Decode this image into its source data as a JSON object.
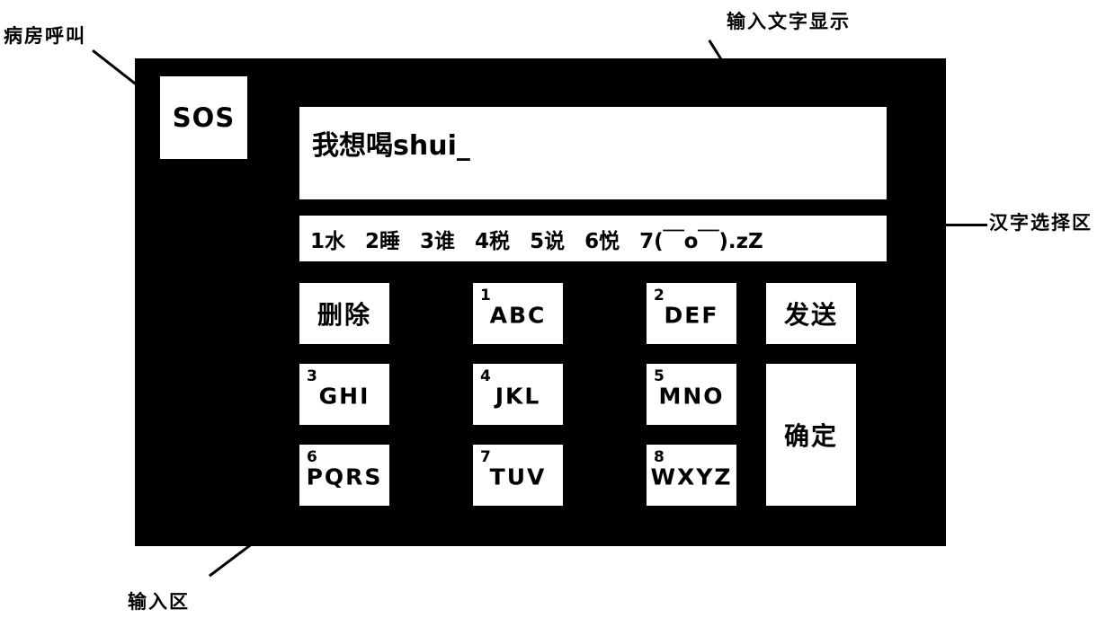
{
  "callouts": {
    "ward_call": "病房呼叫",
    "text_display": "输入文字显示",
    "hanzi_selection": "汉字选择区",
    "input_area": "输入区"
  },
  "device": {
    "frame_color": "#000000",
    "key_color": "#ffffff",
    "sos": {
      "label": "SOS"
    },
    "text_display": {
      "value": "我想喝shui_"
    },
    "candidates": [
      "1水",
      "2睡",
      "3谁",
      "4税",
      "5说",
      "6悦",
      "7(￣o￣).zZ"
    ],
    "keypad": {
      "keys": [
        {
          "digit": "",
          "letters": "",
          "cjk": "删除"
        },
        {
          "digit": "1",
          "letters": "ABC",
          "cjk": ""
        },
        {
          "digit": "2",
          "letters": "DEF",
          "cjk": ""
        },
        {
          "digit": "",
          "letters": "",
          "cjk": "发送"
        },
        {
          "digit": "3",
          "letters": "GHI",
          "cjk": ""
        },
        {
          "digit": "4",
          "letters": "JKL",
          "cjk": ""
        },
        {
          "digit": "5",
          "letters": "MNO",
          "cjk": ""
        },
        {
          "digit": "6",
          "letters": "PQRS",
          "cjk": ""
        },
        {
          "digit": "7",
          "letters": "TUV",
          "cjk": ""
        },
        {
          "digit": "8",
          "letters": "WXYZ",
          "cjk": ""
        }
      ],
      "confirm": {
        "cjk": "确定"
      }
    }
  }
}
